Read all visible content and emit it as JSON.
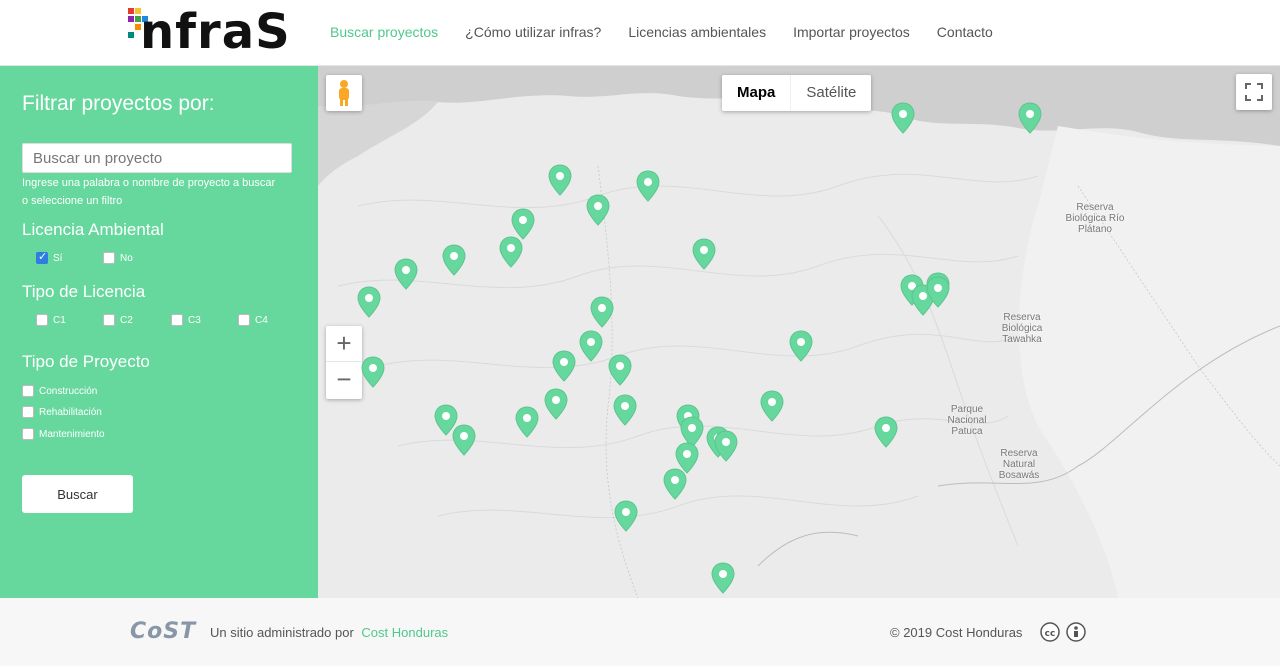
{
  "brand": {
    "logo_text": "nfraS",
    "accent": "#66d79d",
    "link_color": "#4fc88e"
  },
  "nav": {
    "items": [
      {
        "label": "Buscar proyectos",
        "active": true
      },
      {
        "label": "¿Cómo utilizar infras?",
        "active": false
      },
      {
        "label": "Licencias ambientales",
        "active": false
      },
      {
        "label": "Importar proyectos",
        "active": false
      },
      {
        "label": "Contacto",
        "active": false
      }
    ]
  },
  "sidebar": {
    "title": "Filtrar proyectos por:",
    "search_placeholder": "Buscar un proyecto",
    "search_help": "Ingrese una palabra o nombre de proyecto a buscar o seleccione un filtro",
    "licencia_heading": "Licencia Ambiental",
    "licencia_options": [
      {
        "label": "Sí",
        "checked": true
      },
      {
        "label": "No",
        "checked": false
      }
    ],
    "tipo_licencia_heading": "Tipo de Licencia",
    "tipo_licencia_options": [
      {
        "label": "C1"
      },
      {
        "label": "C2"
      },
      {
        "label": "C3"
      },
      {
        "label": "C4"
      }
    ],
    "tipo_proyecto_heading": "Tipo de Proyecto",
    "tipo_proyecto_options": [
      {
        "label": "Construcción"
      },
      {
        "label": "Rehabilitación"
      },
      {
        "label": "Mantenimiento"
      }
    ],
    "search_button": "Buscar"
  },
  "map": {
    "map_type_options": [
      {
        "label": "Mapa",
        "selected": true
      },
      {
        "label": "Satélite",
        "selected": false
      }
    ],
    "zoom_in": "+",
    "zoom_out": "−",
    "labels": {
      "rio_platano": "Reserva Biológica Río Plátano",
      "tawahka": "Reserva Biológica Tawahka",
      "patuca": "Parque Nacional Patuca",
      "bosawas": "Reserva Natural Bosawás"
    },
    "pin_icon": "map-marker-icon",
    "pin_count": 36
  },
  "footer": {
    "cost_logo": "CoST",
    "managed_text": "Un sitio administrado por",
    "managed_link": "Cost Honduras",
    "copyright": "© 2019 Cost Honduras",
    "license_icons": [
      "creative-commons-icon",
      "attribution-icon"
    ]
  }
}
